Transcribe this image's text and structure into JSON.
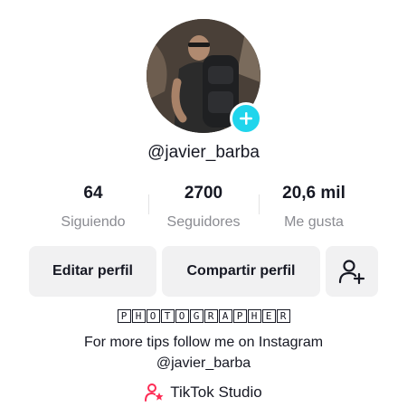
{
  "profile": {
    "username": "@javier_barba",
    "avatar_alt": "profile-photo",
    "add_icon": "plus-icon"
  },
  "stats": [
    {
      "value": "64",
      "label": "Siguiendo"
    },
    {
      "value": "2700",
      "label": "Seguidores"
    },
    {
      "value": "20,6 mil",
      "label": "Me gusta"
    }
  ],
  "actions": {
    "edit_label": "Editar perfil",
    "share_label": "Compartir perfil",
    "add_friend_icon": "add-user-icon"
  },
  "bio": {
    "tag_letters": [
      "P",
      "H",
      "O",
      "T",
      "O",
      "G",
      "R",
      "A",
      "P",
      "H",
      "E",
      "R"
    ],
    "line1": "For more tips follow me on Instagram",
    "line2": "@javier_barba"
  },
  "studio": {
    "label": "TikTok Studio",
    "icon": "studio-icon",
    "icon_color": "#fe2c55"
  },
  "colors": {
    "accent": "#20d5ec",
    "button_bg": "#f1f1f2",
    "muted_text": "#8a8b91"
  }
}
